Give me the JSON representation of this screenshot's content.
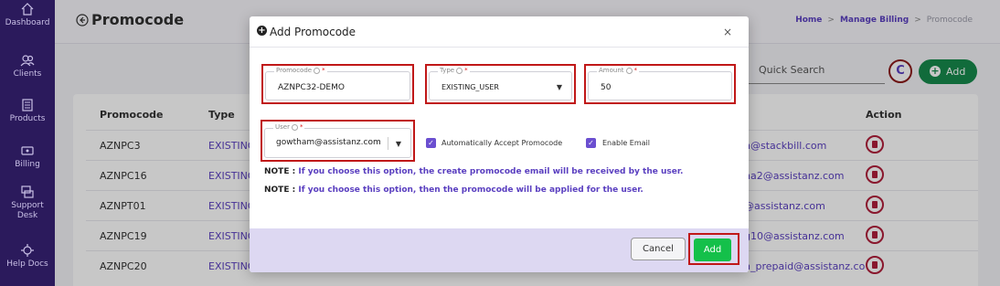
{
  "sidebar": {
    "items": [
      {
        "label": "Dashboard",
        "icon": "home-icon"
      },
      {
        "label": "Clients",
        "icon": "users-icon"
      },
      {
        "label": "Products",
        "icon": "products-icon"
      },
      {
        "label": "Billing",
        "icon": "billing-icon"
      },
      {
        "label": "Support Desk",
        "icon": "support-icon"
      },
      {
        "label": "Help Docs",
        "icon": "help-icon"
      }
    ]
  },
  "header": {
    "title": "Promocode",
    "breadcrumb": {
      "home": "Home",
      "billing": "Manage Billing",
      "current": "Promocode"
    }
  },
  "toolbar": {
    "search_placeholder": "Quick Search",
    "refresh_symbol": "C",
    "add_label": "Add"
  },
  "table": {
    "headers": {
      "code": "Promocode",
      "type": "Type",
      "action": "Action"
    },
    "rows": [
      {
        "code": "AZNPC3",
        "type": "EXISTING",
        "email": "n@stackbill.com"
      },
      {
        "code": "AZNPC16",
        "type": "EXISTING",
        "email": "na2@assistanz.com"
      },
      {
        "code": "AZNPT01",
        "type": "EXISTING",
        "email": "@assistanz.com"
      },
      {
        "code": "AZNPC19",
        "type": "EXISTING",
        "email": "g10@assistanz.com"
      },
      {
        "code": "AZNPC20",
        "type": "EXISTING",
        "email": "n_prepaid@assistanz.co"
      }
    ]
  },
  "modal": {
    "title": "Add Promocode",
    "close": "×",
    "fields": {
      "promocode": {
        "label": "Promocode",
        "value": "AZNPC32-DEMO"
      },
      "type": {
        "label": "Type",
        "value": "EXISTING_USER"
      },
      "amount": {
        "label": "Amount",
        "value": "50"
      },
      "user": {
        "label": "User",
        "value": "gowtham@assistanz.com"
      }
    },
    "required_mark": "*",
    "checkboxes": {
      "auto_accept": "Automatically Accept Promocode",
      "enable_email": "Enable Email"
    },
    "notes": {
      "prefix": "NOTE :",
      "email": "If you choose this option, the create promocode email will be received by the user.",
      "applied": "If you choose this option, then the promocode will be applied for the user."
    },
    "cancel_label": "Cancel",
    "add_label": "Add"
  },
  "colors": {
    "sidebar": "#2b1a5c",
    "accent": "#5a3fc0",
    "add_button": "#14c04a",
    "highlight": "#c01818"
  }
}
